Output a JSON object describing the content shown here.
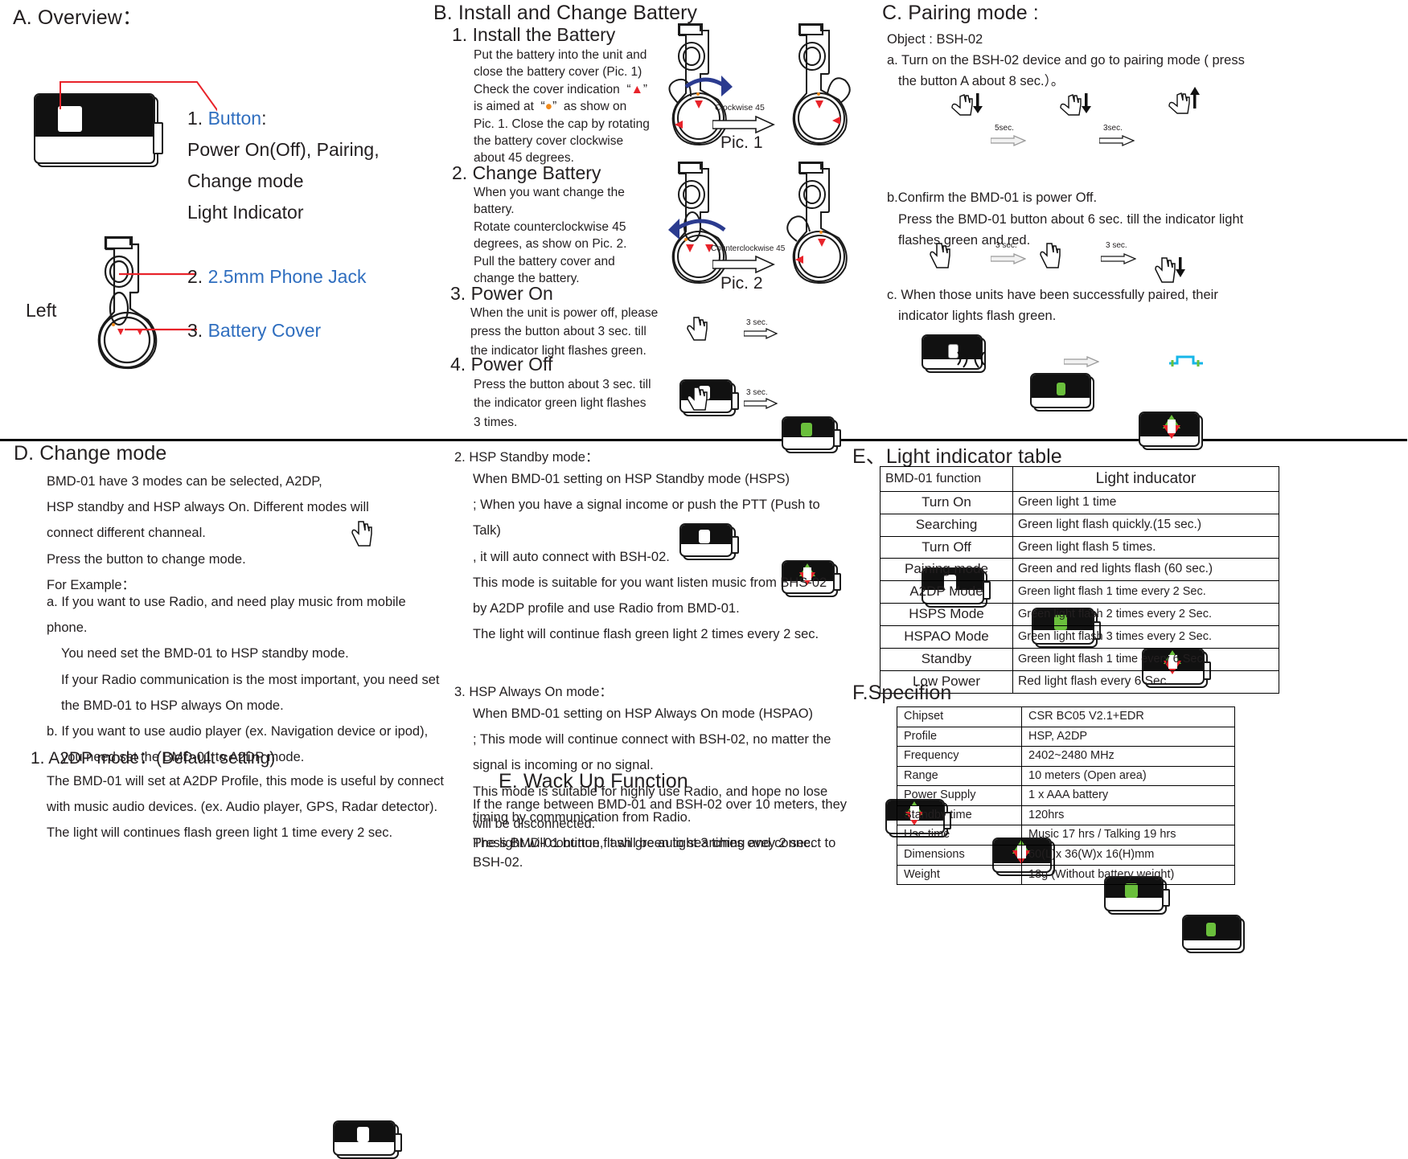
{
  "sections": {
    "a": {
      "title": "A. Overview：",
      "left_label": "Left",
      "items": [
        {
          "num": "1.",
          "link": "Button",
          "suffix": ":",
          "lines": [
            "Power On(Off), Pairing,",
            "Change mode",
            "Light Indicator"
          ]
        },
        {
          "num": "2.",
          "link": "2.5mm Phone Jack",
          "suffix": ""
        },
        {
          "num": "3.",
          "link": "Battery Cover",
          "suffix": ""
        }
      ]
    },
    "b": {
      "title": "B. Install and Change Battery",
      "step1": {
        "heading": "1. Install the Battery",
        "lines": [
          "Put the battery into the unit and",
          "close the battery cover (Pic. 1)",
          "Check the cover indication  “▲”",
          "is aimed at  “ ● ”  as show on",
          "Pic. 1. Close the cap by rotating",
          "the battery cover clockwise",
          "about 45 degrees."
        ],
        "arrow_label": "Clockwise 45",
        "pic_label": "Pic. 1"
      },
      "step2": {
        "heading": "2. Change Battery",
        "lines": [
          "When you want change the",
          "battery.",
          "Rotate counterclockwise 45",
          "degrees, as show on Pic. 2.",
          "Pull the battery cover and",
          "change the battery."
        ],
        "arrow_label": "Counterclockwise 45",
        "pic_label": "Pic. 2"
      },
      "step3": {
        "heading": "3. Power On",
        "lines": [
          "When the unit is power off, please",
          "press the button about 3 sec. till",
          "the indicator light flashes green."
        ],
        "arrow_label": "3 sec."
      },
      "step4": {
        "heading": "4. Power Off",
        "lines": [
          "Press the button about 3 sec. till",
          "the indicator green light flashes",
          "3 times."
        ],
        "arrow_label": "3 sec."
      }
    },
    "c": {
      "title": "C. Pairing mode :",
      "object": "Object : BSH-02",
      "a_lines": [
        "a. Turn on the BSH-02 device and go to pairing mode ( press",
        "the button A about 8 sec.）。"
      ],
      "a_arrows": [
        "5sec.",
        "3sec."
      ],
      "b_lines": [
        "b.Confirm the BMD-01 is power Off.",
        "Press the BMD-01 button about 6 sec. till the indicator light",
        "flashes green and red."
      ],
      "b_arrows": [
        "3 sec.",
        "3 sec."
      ],
      "c_lines": [
        "c. When those units have been successfully paired, their",
        "indicator lights flash green."
      ]
    },
    "d": {
      "title": "D. Change mode",
      "intro": [
        "BMD-01 have 3 modes can be selected, A2DP,",
        "HSP standby and HSP always On. Different modes will",
        "connect different channeal.",
        "Press the button to change mode.",
        "For Example："
      ],
      "examples": [
        "a. If you want to use Radio, and need play music from mobile phone.",
        "You need set the BMD-01 to HSP standby mode.",
        "If your Radio communication is the most important, you need set",
        "the BMD-01 to HSP always On mode.",
        "b. If you want to use audio player (ex. Navigation device or ipod),",
        "you need set the BMD-01 to A2DP mode."
      ],
      "mode1": {
        "heading": "1. A2DP mode：(Default setting)",
        "lines": [
          "The BMD-01 will set at A2DP Profile, this mode is useful by connect",
          "with music audio devices. (ex. Audio player, GPS, Radar detector).",
          "The light will continues flash green light 1 time every 2 sec."
        ]
      },
      "mode2": {
        "heading": "2. HSP Standby mode：",
        "lines": [
          "When BMD-01 setting on HSP Standby mode (HSPS)",
          "; When you have a signal income or push the PTT (Push to Talk)",
          ", it will auto connect with BSH-02.",
          "This mode is suitable for you want listen music from BHS-02",
          "by A2DP profile and use Radio from BMD-01.",
          "The light will continue flash green light 2 times every 2 sec."
        ]
      },
      "mode3": {
        "heading": "3. HSP Always On mode：",
        "lines": [
          "When BMD-01 setting on HSP Always On mode (HSPAO)",
          "; This mode will continue connect with BSH-02, no matter the",
          "signal is incoming or no signal.",
          "This mode is suitable for highly use Radio, and hope no lose",
          "timing by communication from Radio.",
          "The light will continue flash green light 3 times evey 2 sec."
        ]
      }
    },
    "e_wack": {
      "title": "E. Wack Up Function",
      "lines": [
        "If the range between BMD-01 and BSH-02 over 10 meters, they",
        " will be disconnected.",
        "Press BMD-01 button, it will be auto searching and connect to",
        "BSH-02."
      ]
    },
    "e_table": {
      "title": "E、Light indicator table",
      "headers": [
        "BMD-01 function",
        "Light inducator"
      ],
      "rows": [
        [
          "Turn On",
          "Green light 1 time"
        ],
        [
          "Searching",
          "Green light flash quickly.(15 sec.)"
        ],
        [
          "Turn Off",
          "Green light flash 5 times."
        ],
        [
          "Paining mode",
          "Green and red lights flash (60 sec.)"
        ],
        [
          "A2DP Mode",
          "Green light flash 1 time every 2 Sec."
        ],
        [
          "HSPS Mode",
          "Green light flash 2 times every 2 Sec."
        ],
        [
          "HSPAO Mode",
          "Green light flash 3 times every 2 Sec."
        ],
        [
          "Standby",
          "Green light flash 1 time every 6 Sec."
        ],
        [
          "Low Power",
          "Red light flash every 6 Sec."
        ]
      ]
    },
    "f_table": {
      "title": "F.Specifion",
      "rows": [
        [
          "Chipset",
          "CSR BC05 V2.1+EDR"
        ],
        [
          "Profile",
          "HSP, A2DP"
        ],
        [
          "Frequency",
          "2402~2480 MHz"
        ],
        [
          "Range",
          "10 meters (Open area)"
        ],
        [
          "Power Supply",
          "1 x AAA battery"
        ],
        [
          "Standby time",
          "120hrs"
        ],
        [
          "Use time",
          "Music 17 hrs / Talking 19 hrs"
        ],
        [
          "Dimensions",
          "60(L)x 36(W)x 16(H)mm"
        ],
        [
          "Weight",
          "18g (Without battery weight)"
        ]
      ]
    }
  },
  "colors": {
    "link": "#2f6ebf",
    "red": "#e8232a",
    "green": "#6abf3c",
    "blue_arrow": "#2b3b8f",
    "cyan": "#16b6e8",
    "orange": "#f08a1c"
  }
}
